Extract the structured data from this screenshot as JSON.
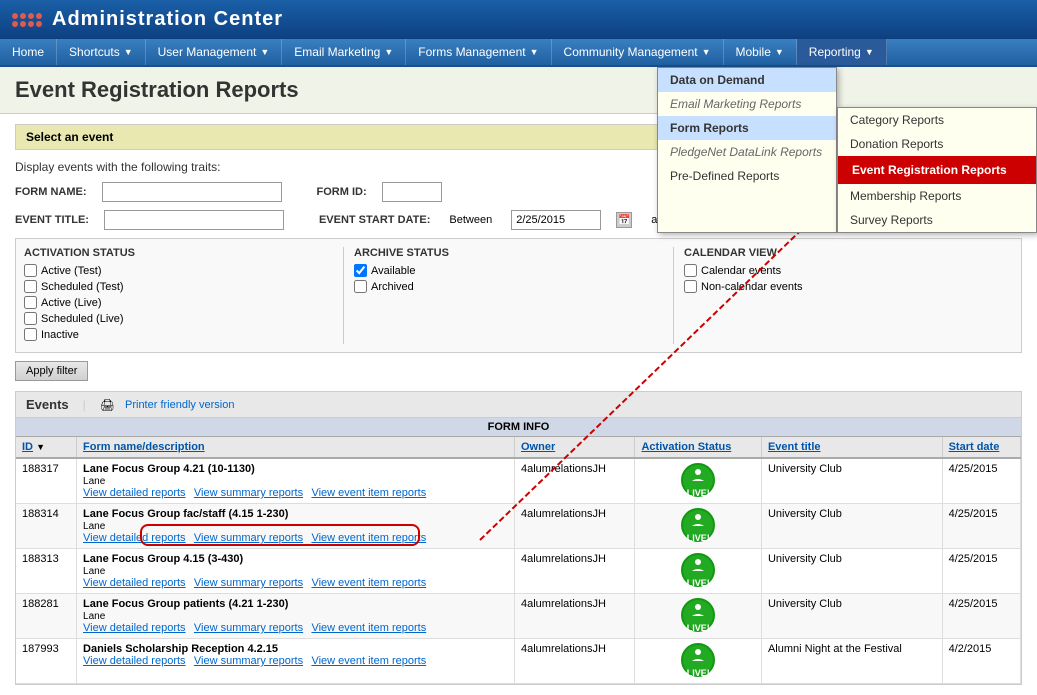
{
  "header": {
    "title": "Administration Center",
    "logo_alt": "logo"
  },
  "nav": {
    "items": [
      {
        "label": "Home",
        "hasDropdown": false
      },
      {
        "label": "Shortcuts",
        "hasDropdown": true
      },
      {
        "label": "User Management",
        "hasDropdown": true
      },
      {
        "label": "Email Marketing",
        "hasDropdown": true
      },
      {
        "label": "Forms Management",
        "hasDropdown": true
      },
      {
        "label": "Community Management",
        "hasDropdown": true
      },
      {
        "label": "Mobile",
        "hasDropdown": true
      },
      {
        "label": "Reporting",
        "hasDropdown": true,
        "active": true
      }
    ]
  },
  "reporting_dropdown": {
    "primary": [
      {
        "label": "Data on Demand",
        "highlighted": true
      },
      {
        "label": "Email Marketing Reports",
        "italic": true
      },
      {
        "label": "Form Reports",
        "highlighted": true
      },
      {
        "label": "PledgeNet DataLink Reports",
        "italic": true
      },
      {
        "label": "Pre-Defined Reports",
        "highlighted": false
      }
    ],
    "secondary": [
      {
        "label": "Category Reports"
      },
      {
        "label": "Donation Reports"
      },
      {
        "label": "Event Registration Reports",
        "active": true
      },
      {
        "label": "Membership Reports"
      },
      {
        "label": "Survey Reports"
      }
    ]
  },
  "page_title": "Event Registration Reports",
  "section_header": "Select an event",
  "filter_label": "Display events with the following traits:",
  "form_name_label": "FORM NAME:",
  "form_id_label": "FORM ID:",
  "event_title_label": "EVENT TITLE:",
  "event_start_date_label": "EVENT START DATE:",
  "between_label": "Between",
  "and_label": "and",
  "start_date_value": "2/25/2015",
  "activation_status": {
    "title": "ACTIVATION STATUS",
    "items": [
      {
        "label": "Active (Test)",
        "checked": false
      },
      {
        "label": "Scheduled (Test)",
        "checked": false
      },
      {
        "label": "Active (Live)",
        "checked": false
      },
      {
        "label": "Scheduled (Live)",
        "checked": false
      },
      {
        "label": "Inactive",
        "checked": false
      }
    ]
  },
  "archive_status": {
    "title": "ARCHIVE STATUS",
    "items": [
      {
        "label": "Available",
        "checked": true
      },
      {
        "label": "Archived",
        "checked": false
      }
    ]
  },
  "calendar_view": {
    "title": "CALENDAR VIEW",
    "items": [
      {
        "label": "Calendar events",
        "checked": false
      },
      {
        "label": "Non-calendar events",
        "checked": false
      }
    ]
  },
  "apply_filter_label": "Apply filter",
  "events_section": {
    "title": "Events",
    "printer_label": "Printer friendly version",
    "form_info_label": "FORM INFO",
    "columns": [
      {
        "label": "ID",
        "sortable": true
      },
      {
        "label": "Form name/description",
        "sortable": true
      },
      {
        "label": "Owner",
        "sortable": true
      },
      {
        "label": "Activation Status",
        "sortable": true
      },
      {
        "label": "Event title",
        "sortable": true
      },
      {
        "label": "Start date",
        "sortable": true
      }
    ],
    "rows": [
      {
        "id": "188317",
        "form_name": "Lane Focus Group 4.21 (10-1130)",
        "form_subtitle": "Lane",
        "links": [
          "View detailed reports",
          "View summary reports",
          "View event item reports"
        ],
        "owner": "4alumrelationsJH",
        "activation": "LIVE!",
        "event_title": "University Club",
        "start_date": "4/25/2015"
      },
      {
        "id": "188314",
        "form_name": "Lane Focus Group fac/staff (4.15 1-230)",
        "form_subtitle": "Lane",
        "links": [
          "View detailed reports",
          "View summary reports",
          "View event item reports"
        ],
        "owner": "4alumrelationsJH",
        "activation": "LIVE!",
        "event_title": "University Club",
        "start_date": "4/25/2015"
      },
      {
        "id": "188313",
        "form_name": "Lane Focus Group 4.15 (3-430)",
        "form_subtitle": "Lane",
        "links": [
          "View detailed reports",
          "View summary reports",
          "View event item reports"
        ],
        "owner": "4alumrelationsJH",
        "activation": "LIVE!",
        "event_title": "University Club",
        "start_date": "4/25/2015"
      },
      {
        "id": "188281",
        "form_name": "Lane Focus Group patients (4.21 1-230)",
        "form_subtitle": "Lane",
        "links": [
          "View detailed reports",
          "View summary reports",
          "View event item reports"
        ],
        "owner": "4alumrelationsJH",
        "activation": "LIVE!",
        "event_title": "University Club",
        "start_date": "4/25/2015"
      },
      {
        "id": "187993",
        "form_name": "Daniels Scholarship Reception 4.2.15",
        "form_subtitle": "",
        "links": [
          "View detailed reports",
          "View summary reports",
          "View event item reports"
        ],
        "owner": "4alumrelationsJH",
        "activation": "LIVE!",
        "event_title": "Alumni Night at the Festival",
        "start_date": "4/2/2015"
      }
    ]
  }
}
